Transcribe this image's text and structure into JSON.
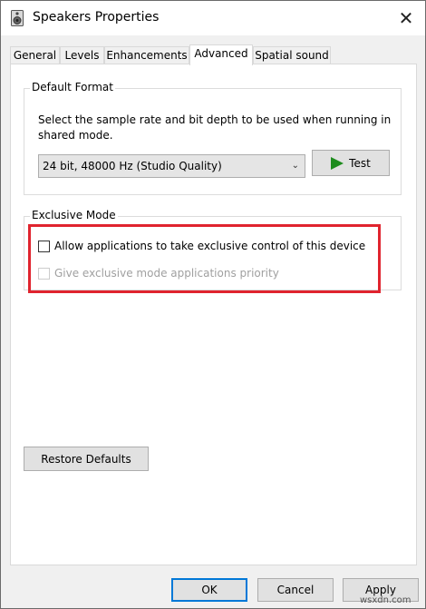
{
  "window": {
    "title": "Speakers Properties",
    "close_glyph": "✕"
  },
  "tabs": [
    {
      "label": "General",
      "active": false
    },
    {
      "label": "Levels",
      "active": false
    },
    {
      "label": "Enhancements",
      "active": false
    },
    {
      "label": "Advanced",
      "active": true
    },
    {
      "label": "Spatial sound",
      "active": false
    }
  ],
  "default_format": {
    "group_label": "Default Format",
    "description": "Select the sample rate and bit depth to be used when running in shared mode.",
    "selected_format": "24 bit, 48000 Hz (Studio Quality)",
    "dropdown_glyph": "⌄",
    "test_button_label": "Test"
  },
  "exclusive_mode": {
    "group_label": "Exclusive Mode",
    "options": [
      {
        "label": "Allow applications to take exclusive control of this device",
        "checked": false,
        "disabled": false
      },
      {
        "label": "Give exclusive mode applications priority",
        "checked": false,
        "disabled": true
      }
    ],
    "highlight_color": "#e0242e"
  },
  "restore_defaults_label": "Restore Defaults",
  "footer": {
    "ok_label": "OK",
    "cancel_label": "Cancel",
    "apply_label": "Apply"
  },
  "watermark": "wsxdn.com",
  "colors": {
    "accent": "#0078d7",
    "play_icon": "#1e8c1e"
  }
}
